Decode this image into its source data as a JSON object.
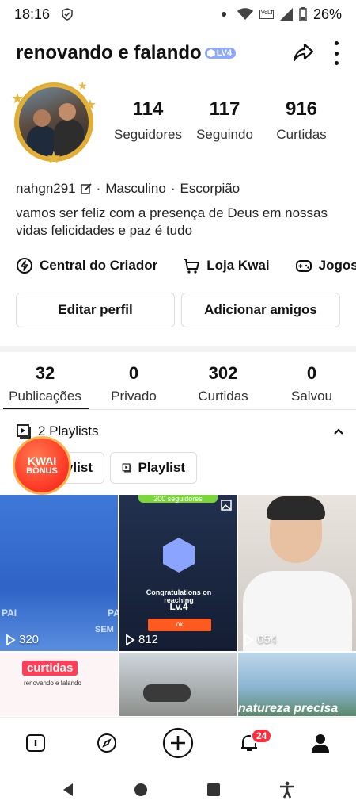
{
  "status_bar": {
    "time": "18:16",
    "battery": "26%",
    "volte": "VoLTE"
  },
  "header": {
    "username": "renovando e falando",
    "level_badge": "LV4"
  },
  "profile": {
    "stats": [
      {
        "value": "114",
        "label": "Seguidores"
      },
      {
        "value": "117",
        "label": "Seguindo"
      },
      {
        "value": "916",
        "label": "Curtidas"
      }
    ],
    "handle": "nahgn291",
    "gender": "Masculino",
    "sign": "Escorpião",
    "separator": "·",
    "bio": "vamos ser feliz com a presença de Deus em nossas vidas felicidades e paz é tudo"
  },
  "links": [
    {
      "label": "Central do Criador",
      "icon": "lightning-icon"
    },
    {
      "label": "Loja Kwai",
      "icon": "cart-icon"
    },
    {
      "label": "Jogos",
      "icon": "gamepad-icon"
    }
  ],
  "buttons": {
    "edit": "Editar perfil",
    "add": "Adicionar amigos"
  },
  "tabs": [
    {
      "value": "32",
      "label": "Publicações"
    },
    {
      "value": "0",
      "label": "Privado"
    },
    {
      "value": "302",
      "label": "Curtidas"
    },
    {
      "value": "0",
      "label": "Salvou"
    }
  ],
  "playlists": {
    "title": "2 Playlists",
    "items": [
      "Playlist",
      "Playlist"
    ],
    "bonus_line1": "KWAI",
    "bonus_line2": "BÔNUS"
  },
  "grid": {
    "tiles": [
      {
        "views": "320",
        "text_left": "PAI",
        "text_right": "PA",
        "text_right2": "SEM"
      },
      {
        "views": "812",
        "followers_tag": "200 seguidores",
        "congrats": "Congratulations on reaching",
        "level": "Lv.4",
        "ok": "ok"
      },
      {
        "views": "654"
      },
      {
        "banner": "curtidas",
        "caption": "renovando e falando"
      },
      {},
      {
        "overlay_text": "natureza precisa"
      }
    ]
  },
  "bottom_nav": {
    "notification_count": "24"
  },
  "colors": {
    "accent": "#ff5a1f",
    "badge": "#ff2d3b",
    "level": "#8ea8ff",
    "gold": "#e7b43a"
  }
}
